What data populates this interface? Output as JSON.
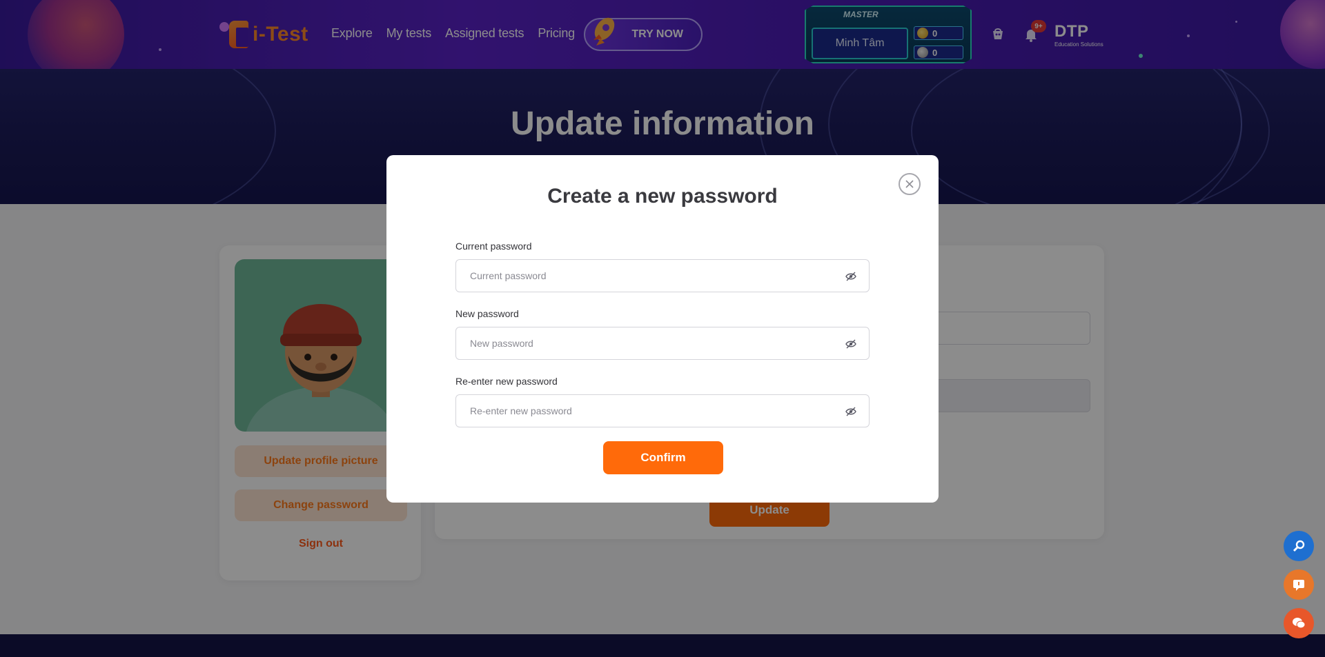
{
  "header": {
    "logo_text": "i-Test",
    "nav": [
      "Explore",
      "My tests",
      "Assigned tests",
      "Pricing"
    ],
    "try_now": "TRY NOW",
    "rank": {
      "title": "MASTER",
      "name": "Minh Tâm",
      "gold_coins": "0",
      "silver_coins": "0"
    },
    "notification_badge": "9+",
    "brand": {
      "name": "DTP",
      "tagline": "Education Solutions"
    }
  },
  "hero": {
    "title": "Update information"
  },
  "sidebar": {
    "update_picture": "Update profile picture",
    "change_password": "Change password",
    "sign_out": "Sign out"
  },
  "form": {
    "update_label": "Update"
  },
  "modal": {
    "title": "Create a new password",
    "fields": [
      {
        "label": "Current password",
        "placeholder": "Current password",
        "value": ""
      },
      {
        "label": "New password",
        "placeholder": "New password",
        "value": ""
      },
      {
        "label": "Re-enter new password",
        "placeholder": "Re-enter new password",
        "value": ""
      }
    ],
    "confirm_label": "Confirm"
  },
  "colors": {
    "accent": "#ff6a0a",
    "header_bg": "#4a1cb4",
    "hero_bg": "#1c1c5a"
  },
  "icons": [
    "close-icon",
    "eye-off-icon",
    "cart-icon",
    "bell-icon",
    "search-icon",
    "chat-icon",
    "messenger-icon",
    "rocket-icon"
  ]
}
